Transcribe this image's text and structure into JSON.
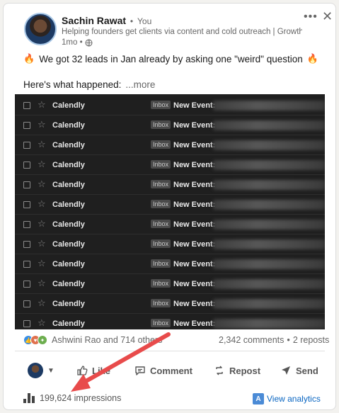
{
  "post": {
    "author_name": "Sachin Rawat",
    "author_sep": "•",
    "author_you": "You",
    "headline": "Helping founders get clients via content and cold outreach | Growth...",
    "time": "1mo •",
    "more_icon": "ellipsis-icon",
    "close_icon": "close-icon",
    "line1": "We got 32 leads in Jan already by asking one \"weird\" question",
    "line2": "Here's what happened:",
    "see_more": "...more"
  },
  "inbox": {
    "sender": "Calendly",
    "badge": "Inbox",
    "subject": "New Event:",
    "row_count": 12
  },
  "social": {
    "reactors": "Ashwini Rao and 714 others",
    "comments": "2,342 comments",
    "sep": "•",
    "reposts": "2 reposts"
  },
  "actions": {
    "like": "Like",
    "comment": "Comment",
    "repost": "Repost",
    "send": "Send"
  },
  "footer": {
    "impressions": "199,624 impressions",
    "analytics": "View analytics"
  },
  "colors": {
    "accent": "#0a66c2",
    "arrow": "#e84b4b",
    "inbox_bg": "#1f1f1f"
  }
}
